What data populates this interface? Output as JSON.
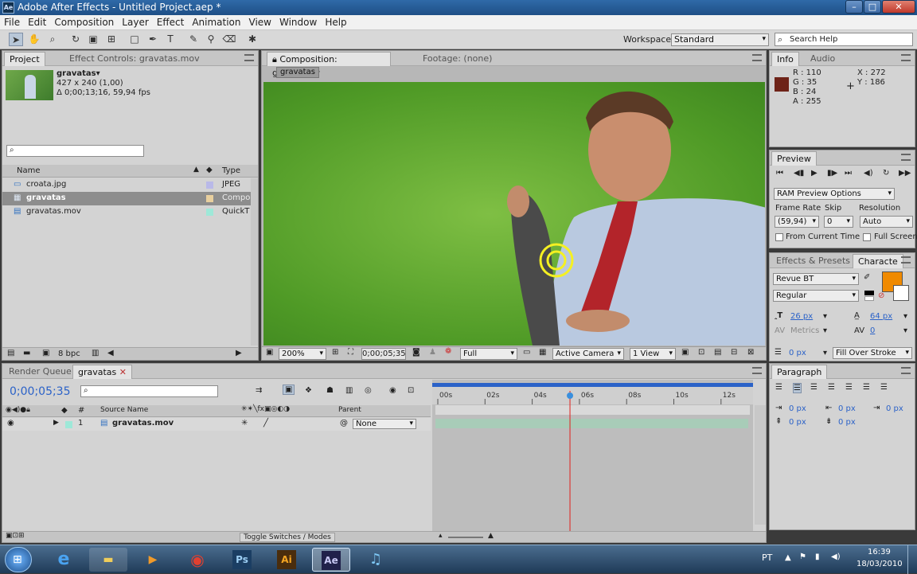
{
  "window": {
    "title": "Adobe After Effects - Untitled Project.aep *",
    "app_icon": "Ae"
  },
  "menu": [
    "File",
    "Edit",
    "Composition",
    "Layer",
    "Effect",
    "Animation",
    "View",
    "Window",
    "Help"
  ],
  "toolbar": {
    "workspace_label": "Workspace:",
    "workspace_value": "Standard",
    "search_placeholder": "Search Help"
  },
  "project": {
    "tab_project": "Project",
    "tab_effects": "Effect Controls: gravatas.mov",
    "item_name": "gravatas▾",
    "item_size": "427 x 240 (1,00)",
    "item_duration": "Δ 0;00;13;16, 59,94 fps",
    "col_name": "Name",
    "col_type": "Type",
    "items": [
      {
        "name": "croata.jpg",
        "type": "JPEG",
        "color": "#b9b9e8"
      },
      {
        "name": "gravatas",
        "type": "Compo",
        "color": "#e8cf9e"
      },
      {
        "name": "gravatas.mov",
        "type": "QuickT",
        "color": "#9ee8d8"
      }
    ],
    "bpc": "8 bpc"
  },
  "composition": {
    "tab": "Composition: gravatas",
    "footage_tab": "Footage: (none)",
    "comp_button": "gravatas",
    "zoom": "200%",
    "timecode": "0;00;05;35",
    "resolution": "Full",
    "camera": "Active Camera",
    "views": "1 View"
  },
  "info": {
    "tab_info": "Info",
    "tab_audio": "Audio",
    "r": "R : 110",
    "g": "G : 35",
    "b": "B : 24",
    "a": "A : 255",
    "x": "X : 272",
    "y": "Y : 186",
    "swatch": "#6e2318"
  },
  "preview": {
    "tab": "Preview",
    "ram_options": "RAM Preview Options",
    "frame_rate_label": "Frame Rate",
    "skip_label": "Skip",
    "resolution_label": "Resolution",
    "frame_rate": "(59,94)",
    "skip": "0",
    "resolution": "Auto",
    "from_current": "From Current Time",
    "full_screen": "Full Screen"
  },
  "character": {
    "tab_effects": "Effects & Presets",
    "tab_character": "Characte",
    "font": "Revue BT",
    "style": "Regular",
    "size": "26 px",
    "leading": "64 px",
    "kerning": "Metrics",
    "tracking": "0",
    "stroke_width": "0 px",
    "stroke_mode": "Fill Over Stroke",
    "fill_color": "#f08a00"
  },
  "paragraph": {
    "tab": "Paragraph",
    "indent1": "0 px",
    "indent2": "0 px",
    "indent3": "0 px",
    "space1": "0 px",
    "space2": "0 px"
  },
  "timeline": {
    "tab_render": "Render Queue",
    "tab_comp": "gravatas",
    "timecode": "0;00;05;35",
    "col_hash": "#",
    "col_source": "Source Name",
    "col_parent": "Parent",
    "layer_num": "1",
    "layer_name": "gravatas.mov",
    "parent_value": "None",
    "ruler": [
      "00s",
      "02s",
      "04s",
      "06s",
      "08s",
      "10s",
      "12s"
    ],
    "playhead_seconds": 5.6,
    "toggle_label": "Toggle Switches / Modes"
  },
  "taskbar": {
    "apps": [
      "IE",
      "Files",
      "Media",
      "Chrome",
      "Ps",
      "Ai",
      "Ae",
      "iTunes"
    ],
    "lang": "PT",
    "time": "16:39",
    "date": "18/03/2010"
  }
}
